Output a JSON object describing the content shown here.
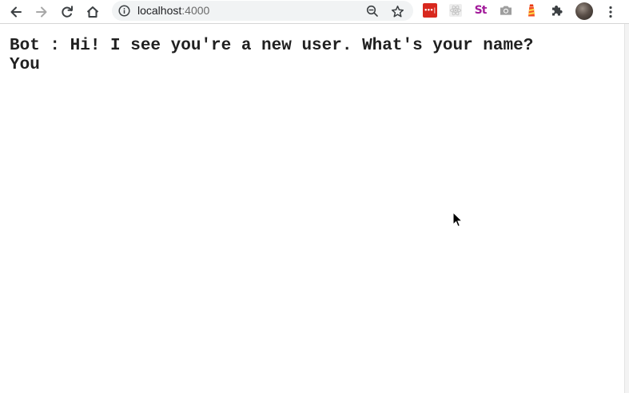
{
  "browser": {
    "address": {
      "host": "localhost",
      "port": ":4000"
    },
    "extensions": {
      "lastpass_label": "•••|",
      "stylus_label": "St"
    }
  },
  "chat": {
    "messages": [
      {
        "text": "Bot : Hi! I see you're a new user. What's your name?"
      },
      {
        "text": "You"
      }
    ]
  },
  "colors": {
    "accent_red": "#d8281e",
    "stylus_purple": "#a31c9b",
    "omnibox_bg": "#f1f3f4"
  }
}
